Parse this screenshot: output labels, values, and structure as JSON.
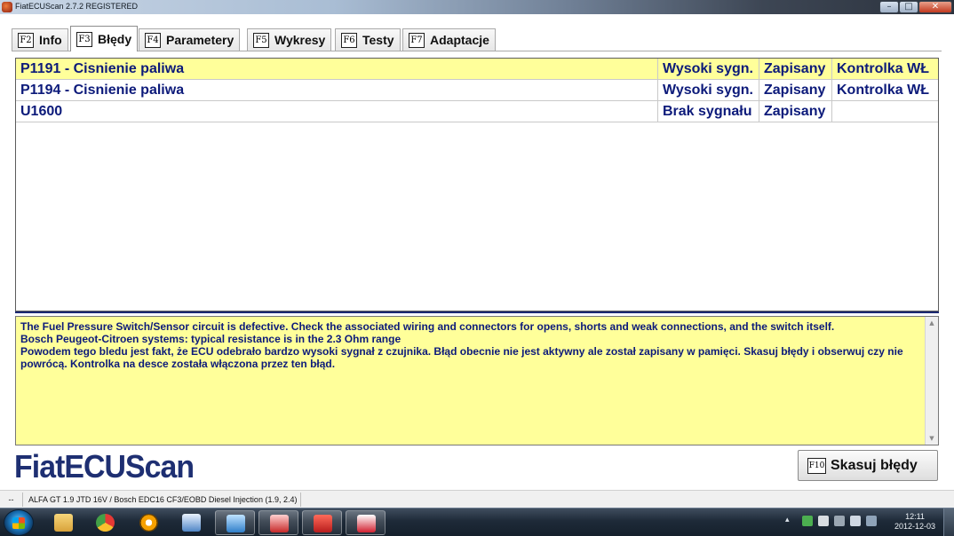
{
  "window": {
    "title": "FiatECUScan 2.7.2 REGISTERED",
    "controls": [
      "minimize-icon",
      "maximize-icon",
      "close-icon"
    ]
  },
  "tabs": [
    {
      "key": "F2",
      "label": "Info",
      "active": false
    },
    {
      "key": "F3",
      "label": "Błędy",
      "active": true
    },
    {
      "key": "F4",
      "label": "Parametery",
      "active": false
    },
    {
      "key": "F5",
      "label": "Wykresy",
      "active": false
    },
    {
      "key": "F6",
      "label": "Testy",
      "active": false
    },
    {
      "key": "F7",
      "label": "Adaptacje",
      "active": false
    }
  ],
  "faults": [
    {
      "code": "P1191 - Cisnienie paliwa",
      "signal": "Wysoki sygn.",
      "status": "Zapisany",
      "lamp": "Kontrolka WŁ",
      "selected": true
    },
    {
      "code": "P1194 - Cisnienie paliwa",
      "signal": "Wysoki sygn.",
      "status": "Zapisany",
      "lamp": "Kontrolka WŁ",
      "selected": false
    },
    {
      "code": "U1600",
      "signal": "Brak sygnału",
      "status": "Zapisany",
      "lamp": "",
      "selected": false
    }
  ],
  "description": {
    "lines": [
      "The Fuel Pressure Switch/Sensor circuit is defective. Check the associated wiring and connectors for opens, shorts and weak connections, and the switch itself.",
      "Bosch Peugeot-Citroen systems: typical resistance is in the 2.3 Ohm range",
      "Powodem tego bledu jest fakt, że ECU odebrało bardzo wysoki sygnał z czujnika. Błąd obecnie nie jest aktywny ale został zapisany w pamięci. Skasuj błędy i obserwuj czy nie powrócą. Kontrolka na desce została włączona przez ten błąd."
    ]
  },
  "brand": {
    "logo": "FiatECUScan"
  },
  "actions": {
    "clear_key": "F10",
    "clear_label": "Skasuj błędy"
  },
  "status_bar": {
    "left": "--",
    "vehicle": "ALFA GT 1.9 JTD 16V / Bosch EDC16 CF3/EOBD Diesel Injection (1.9, 2.4)"
  },
  "taskbar": {
    "start": "windows-start-icon",
    "items": [
      {
        "icon": "explorer-folder-icon",
        "active": false
      },
      {
        "icon": "chrome-icon",
        "active": false
      },
      {
        "icon": "vlc-cone-icon",
        "active": false
      },
      {
        "icon": "chart-app-icon",
        "active": false
      },
      {
        "icon": "remote-desktop-icon",
        "active": false
      },
      {
        "icon": "car-app-icon",
        "active": false
      },
      {
        "icon": "pdf-reader-icon",
        "active": false
      },
      {
        "icon": "fiatecuscan-app-icon",
        "active": true
      }
    ],
    "tray_expand": "▴",
    "time": "12:11",
    "date": "2012-12-03"
  },
  "colors": {
    "selected_row": "#ffff9a",
    "text_blue": "#0c1a7a",
    "logo_blue": "#1e2f72"
  }
}
